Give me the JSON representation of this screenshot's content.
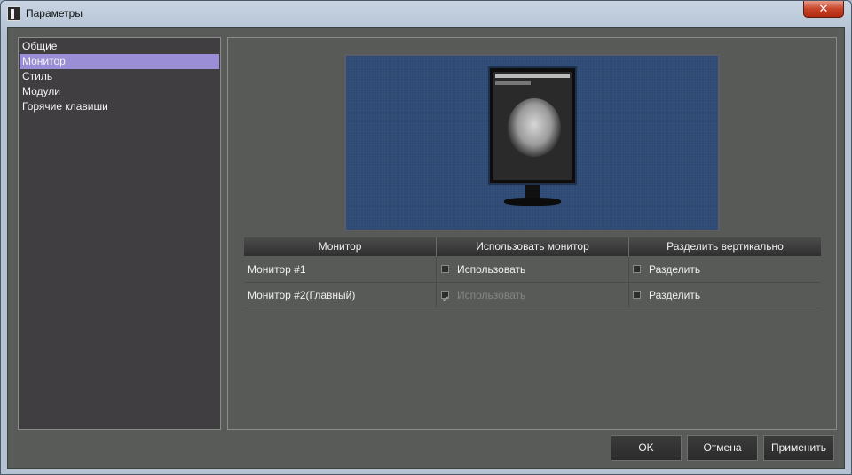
{
  "window": {
    "title": "Параметры",
    "close_glyph": "✕"
  },
  "nav": {
    "items": [
      {
        "label": "Общие"
      },
      {
        "label": "Монитор",
        "selected": true
      },
      {
        "label": "Стиль"
      },
      {
        "label": "Модули"
      },
      {
        "label": "Горячие клавиши"
      }
    ]
  },
  "table": {
    "headers": [
      "Монитор",
      "Использовать монитор",
      "Разделить вертикально"
    ],
    "rows": [
      {
        "name": "Монитор #1",
        "use_label": "Использовать",
        "use_checked": false,
        "use_disabled": false,
        "split_label": "Разделить",
        "split_checked": false
      },
      {
        "name": "Монитор #2(Главный)",
        "use_label": "Использовать",
        "use_checked": true,
        "use_disabled": true,
        "split_label": "Разделить",
        "split_checked": false
      }
    ]
  },
  "buttons": {
    "ok": "OK",
    "cancel": "Отмена",
    "apply": "Применить"
  },
  "colors": {
    "selection": "#9a8fd6",
    "preview_bg": "#2e4a73",
    "panel_bg": "#585a57"
  },
  "icons": {
    "app": "app-icon",
    "close": "close-icon",
    "checkbox": "checkbox-icon"
  }
}
